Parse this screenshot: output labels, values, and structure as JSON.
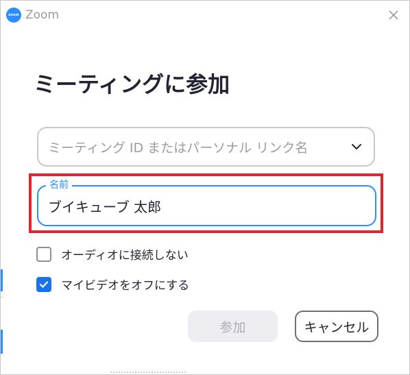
{
  "window": {
    "app_name": "Zoom",
    "logo_text": "zoom",
    "accent_color": "#2d8cff",
    "highlight_color": "#e0262c"
  },
  "dialog": {
    "heading": "ミーティングに参加",
    "meeting_id": {
      "placeholder": "ミーティング ID またはパーソナル リンク名",
      "icon": "chevron-down-icon"
    },
    "name_field": {
      "label": "名前",
      "value": "ブイキューブ 太郎"
    },
    "options": [
      {
        "label": "オーディオに接続しない",
        "checked": false
      },
      {
        "label": "マイビデオをオフにする",
        "checked": true
      }
    ],
    "buttons": {
      "join": "参加",
      "cancel": "キャンセル"
    }
  }
}
